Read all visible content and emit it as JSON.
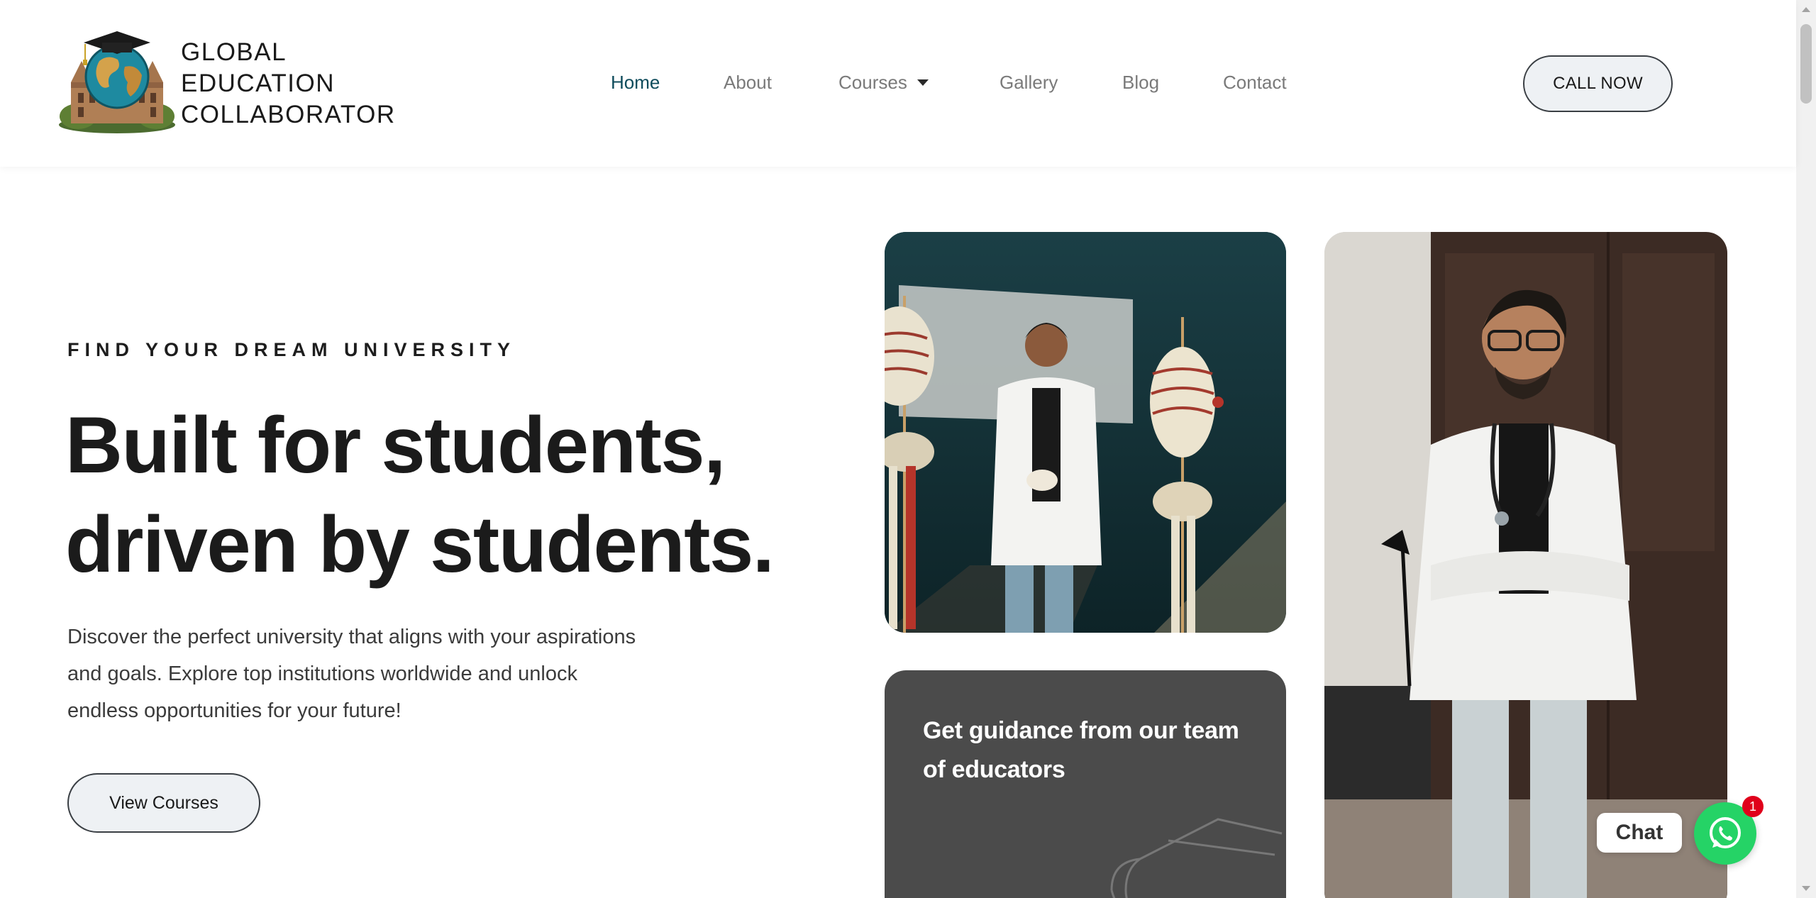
{
  "brand": {
    "line1": "GLOBAL",
    "line2": "EDUCATION",
    "line3": "COLLABORATOR"
  },
  "nav": {
    "home": "Home",
    "about": "About",
    "courses": "Courses",
    "gallery": "Gallery",
    "blog": "Blog",
    "contact": "Contact",
    "active": "Home"
  },
  "header": {
    "cta_label": "CALL NOW"
  },
  "hero": {
    "eyebrow": "FIND YOUR DREAM UNIVERSITY",
    "headline_line1": "Built for students,",
    "headline_line2": "driven by students.",
    "description": "Discover the perfect university that aligns with your aspirations and goals. Explore top institutions worldwide and unlock endless opportunities for your future!",
    "button_label": "View Courses"
  },
  "cards": {
    "guidance_text": "Get guidance from our team of educators"
  },
  "chat": {
    "label": "Chat",
    "badge_count": "1"
  },
  "colors": {
    "accent_nav_active": "#0f4c5c",
    "button_bg": "#eef1f4",
    "card_dark": "#4b4b4b",
    "whatsapp_green": "#25d366",
    "badge_red": "#e0001b"
  }
}
